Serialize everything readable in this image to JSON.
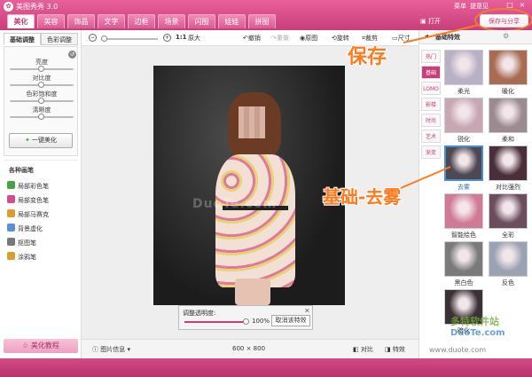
{
  "window": {
    "title": "美图秀秀 3.0",
    "menu": [
      "菜单",
      "提意见"
    ],
    "controls": [
      "_",
      "□",
      "×"
    ]
  },
  "main_tabs": [
    {
      "label": "美化",
      "active": true
    },
    {
      "label": "美容"
    },
    {
      "label": "饰品"
    },
    {
      "label": "文字"
    },
    {
      "label": "边框"
    },
    {
      "label": "场景"
    },
    {
      "label": "闪图"
    },
    {
      "label": "娃娃"
    },
    {
      "label": "拼图"
    }
  ],
  "top_right": {
    "open_label": "打开",
    "save_share_label": "保存与分享"
  },
  "left_panel": {
    "subtabs": [
      "基础调整",
      "色彩调整"
    ],
    "sliders": [
      {
        "label": "亮度",
        "value": 0.5
      },
      {
        "label": "对比度",
        "value": 0.5
      },
      {
        "label": "色彩饱和度",
        "value": 0.5
      },
      {
        "label": "清晰度",
        "value": 0.5
      }
    ],
    "auto_beautify_label": "一键美化",
    "brush_title": "各种画笔",
    "brushes": [
      {
        "label": "局部彩色笔",
        "color": "#4aa14a"
      },
      {
        "label": "局部变色笔",
        "color": "#d64b8f"
      },
      {
        "label": "局部马赛克",
        "color": "#e09a2d"
      },
      {
        "label": "背景虚化",
        "color": "#5b8fd6"
      },
      {
        "label": "抠图笔",
        "color": "#777777"
      },
      {
        "label": "涂鸦笔",
        "color": "#d6a02d"
      }
    ],
    "tutorial_label": "美化教程"
  },
  "toolbar": {
    "zoom_fit_label": "1:1",
    "original_size_label": "原大",
    "undo_label": "撤销",
    "redo_label": "重做",
    "original_label": "原图",
    "rotate_label": "旋转",
    "crop_label": "裁剪",
    "resize_label": "尺寸",
    "zoom_value": 0.05
  },
  "canvas": {
    "watermark_text": "DuoTe.com"
  },
  "opacity_panel": {
    "label": "调整透明度:",
    "value_label": "100%",
    "value": 1.0,
    "cancel_label": "取消该特效"
  },
  "statusbar": {
    "info_label": "图片信息",
    "dimensions": "600 × 800",
    "compare_label": "对比",
    "effects_label": "特效"
  },
  "right_panel": {
    "title": "基础特效",
    "categories": [
      {
        "label": "热门"
      },
      {
        "label": "基础",
        "active": true
      },
      {
        "label": "LOMO"
      },
      {
        "label": "影楼"
      },
      {
        "label": "时尚"
      },
      {
        "label": "艺术"
      },
      {
        "label": "渐变"
      }
    ],
    "thumbnails": [
      {
        "label": "柔光",
        "tone": "#b9b0c6"
      },
      {
        "label": "暖化",
        "tone": "#a86c52"
      },
      {
        "label": "锐化",
        "tone": "#c7a7b3"
      },
      {
        "label": "柔和",
        "tone": "#9b8a8f"
      },
      {
        "label": "去雾",
        "tone": "#4e4852",
        "selected": true
      },
      {
        "label": "对比强烈",
        "tone": "#4a2f3a"
      },
      {
        "label": "智能绘色",
        "tone": "#d07a96"
      },
      {
        "label": "全彩",
        "tone": "#6b4d5d"
      },
      {
        "label": "黑白色",
        "tone": "#7a7a7a"
      },
      {
        "label": "反色",
        "tone": "#9aa2b3"
      },
      {
        "label": "暗化",
        "tone": "#3a3136"
      }
    ]
  },
  "annotations": {
    "save_text": "保存",
    "defog_text": "基础-去雾"
  },
  "site_watermark": {
    "brand_cn": "多特软件站",
    "brand_en": "DuoTe.com",
    "url": "www.duote.com"
  }
}
